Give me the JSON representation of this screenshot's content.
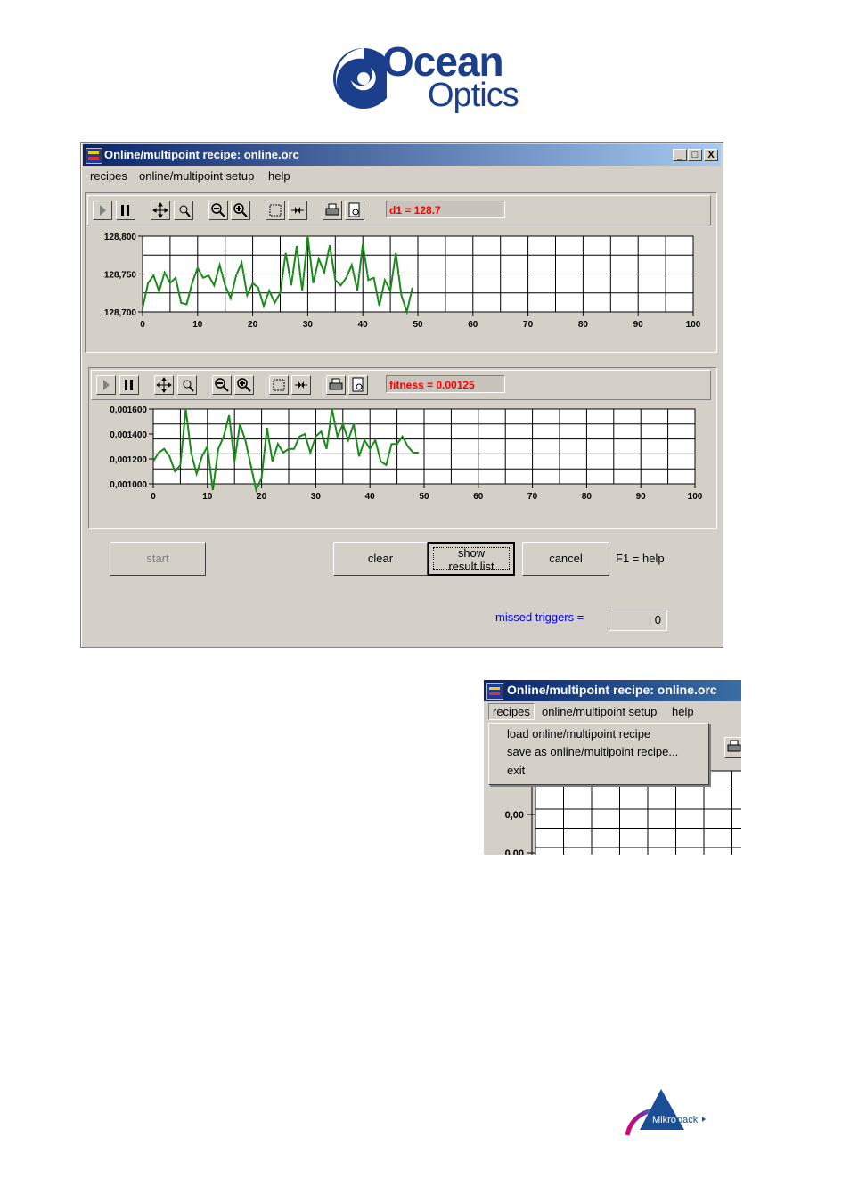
{
  "logo": {
    "line1": "Ocean",
    "line2": "Optics"
  },
  "window": {
    "title": "Online/multipoint recipe: online.orc",
    "caption_buttons": {
      "minimize": "_",
      "maximize": "□",
      "close": "X"
    },
    "menu": [
      "recipes",
      "online/multipoint setup",
      "help"
    ],
    "chart1": {
      "readout": "d1 = 128.7",
      "y_ticks": [
        "128,800",
        "128,750",
        "128,700"
      ],
      "x_ticks": [
        "0",
        "10",
        "20",
        "30",
        "40",
        "50",
        "60",
        "70",
        "80",
        "90",
        "100"
      ]
    },
    "chart2": {
      "readout": "fitness = 0.00125",
      "y_ticks": [
        "0,001600",
        "0,001400",
        "0,001200",
        "0,001000"
      ],
      "x_ticks": [
        "0",
        "10",
        "20",
        "30",
        "40",
        "50",
        "60",
        "70",
        "80",
        "90",
        "100"
      ]
    },
    "buttons": {
      "start": "start",
      "clear": "clear",
      "show_line1": "show",
      "show_line2": "result list",
      "cancel": "cancel"
    },
    "help_hint": "F1 = help",
    "missed_label": "missed triggers =",
    "missed_value": "0",
    "colors": {
      "series": "#1a8a1a",
      "readout": "#ff0000",
      "missed_label": "#0000ff"
    }
  },
  "menu_shot": {
    "title": "Online/multipoint recipe: online.orc",
    "menu": [
      "recipes",
      "online/multipoint setup",
      "help"
    ],
    "dropdown": [
      "load online/multipoint recipe",
      "save as online/multipoint recipe...",
      "exit"
    ],
    "y_ticks": [
      "0,00",
      "0,00"
    ]
  },
  "chart_data": [
    {
      "type": "line",
      "x": [
        0,
        1,
        2,
        3,
        4,
        5,
        6,
        7,
        8,
        9,
        10,
        11,
        12,
        13,
        14,
        15,
        16,
        17,
        18,
        19,
        20,
        21,
        22,
        23,
        24,
        25,
        26,
        27,
        28,
        29,
        30,
        31,
        32,
        33,
        34,
        35,
        36,
        37,
        38,
        39,
        40,
        41,
        42,
        43,
        44,
        45,
        46,
        47,
        48,
        49
      ],
      "series": [
        {
          "values": [
            128.705,
            128.738,
            128.748,
            128.727,
            128.752,
            128.738,
            128.745,
            128.712,
            128.71,
            128.738,
            128.758,
            128.745,
            128.748,
            128.735,
            128.762,
            128.735,
            128.718,
            128.748,
            128.765,
            128.722,
            128.738,
            128.732,
            128.708,
            128.728,
            128.712,
            128.725,
            128.778,
            128.735,
            128.787,
            128.728,
            128.8,
            128.738,
            128.77,
            128.752,
            128.788,
            128.742,
            128.735,
            128.745,
            128.762,
            128.728,
            128.79,
            128.742,
            128.745,
            128.708,
            128.742,
            128.728,
            128.778,
            128.722,
            128.7,
            128.732
          ]
        }
      ],
      "xlim": [
        0,
        100
      ],
      "ylim": [
        128.7,
        128.8
      ],
      "grid": true
    },
    {
      "type": "line",
      "x": [
        0,
        1,
        2,
        3,
        4,
        5,
        6,
        7,
        8,
        9,
        10,
        11,
        12,
        13,
        14,
        15,
        16,
        17,
        18,
        19,
        20,
        21,
        22,
        23,
        24,
        25,
        26,
        27,
        28,
        29,
        30,
        31,
        32,
        33,
        34,
        35,
        36,
        37,
        38,
        39,
        40,
        41,
        42,
        43,
        44,
        45,
        46,
        47,
        48,
        49
      ],
      "series": [
        {
          "values": [
            0.00118,
            0.00125,
            0.00128,
            0.00122,
            0.0011,
            0.00115,
            0.0016,
            0.00125,
            0.00108,
            0.00122,
            0.0013,
            0.00095,
            0.00128,
            0.00138,
            0.00155,
            0.00118,
            0.00148,
            0.00135,
            0.00115,
            0.00095,
            0.00105,
            0.00145,
            0.00118,
            0.00132,
            0.00125,
            0.00128,
            0.00128,
            0.00138,
            0.0014,
            0.00125,
            0.00138,
            0.00142,
            0.00128,
            0.0016,
            0.00138,
            0.00148,
            0.00135,
            0.00148,
            0.00122,
            0.00135,
            0.00128,
            0.00135,
            0.00118,
            0.00115,
            0.00132,
            0.00132,
            0.00138,
            0.0013,
            0.00125,
            0.00125
          ]
        }
      ],
      "xlim": [
        0,
        100
      ],
      "ylim": [
        0.001,
        0.0016
      ],
      "grid": true
    }
  ]
}
